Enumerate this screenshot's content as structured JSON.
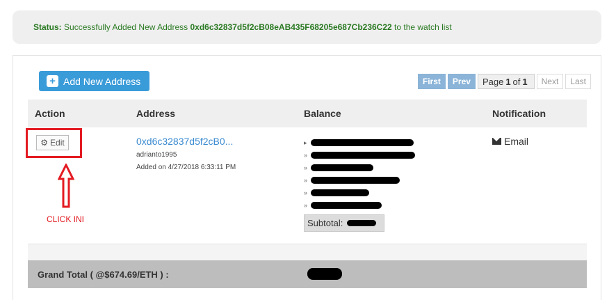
{
  "status": {
    "label": "Status:",
    "message_prefix": "Successfully Added New Address",
    "address": "0xd6c32837d5f2cB08eAB435F68205e687Cb236C22",
    "message_suffix": "to the watch list"
  },
  "toolbar": {
    "add_label": "Add New Address",
    "pager": {
      "first": "First",
      "prev": "Prev",
      "page_word": "Page",
      "current": "1",
      "of_word": "of",
      "total": "1",
      "next": "Next",
      "last": "Last"
    }
  },
  "table": {
    "headers": [
      "Action",
      "Address",
      "Balance",
      "Notification"
    ]
  },
  "row": {
    "edit_label": "Edit",
    "address_short": "0xd6c32837d5f2cB0...",
    "owner": "adrianto1995",
    "added": "Added on 4/27/2018 6:33:11 PM",
    "balances": [
      {
        "marker": "▸"
      },
      {
        "marker": "»"
      },
      {
        "marker": "»"
      },
      {
        "marker": "»"
      },
      {
        "marker": "»"
      },
      {
        "marker": "»"
      }
    ],
    "subtotal_label": "Subtotal:",
    "notification_label": "Email"
  },
  "annotation": {
    "click_label": "CLICK INI"
  },
  "grand_total": {
    "label": "Grand Total ( @$674.69/ETH ) :"
  }
}
